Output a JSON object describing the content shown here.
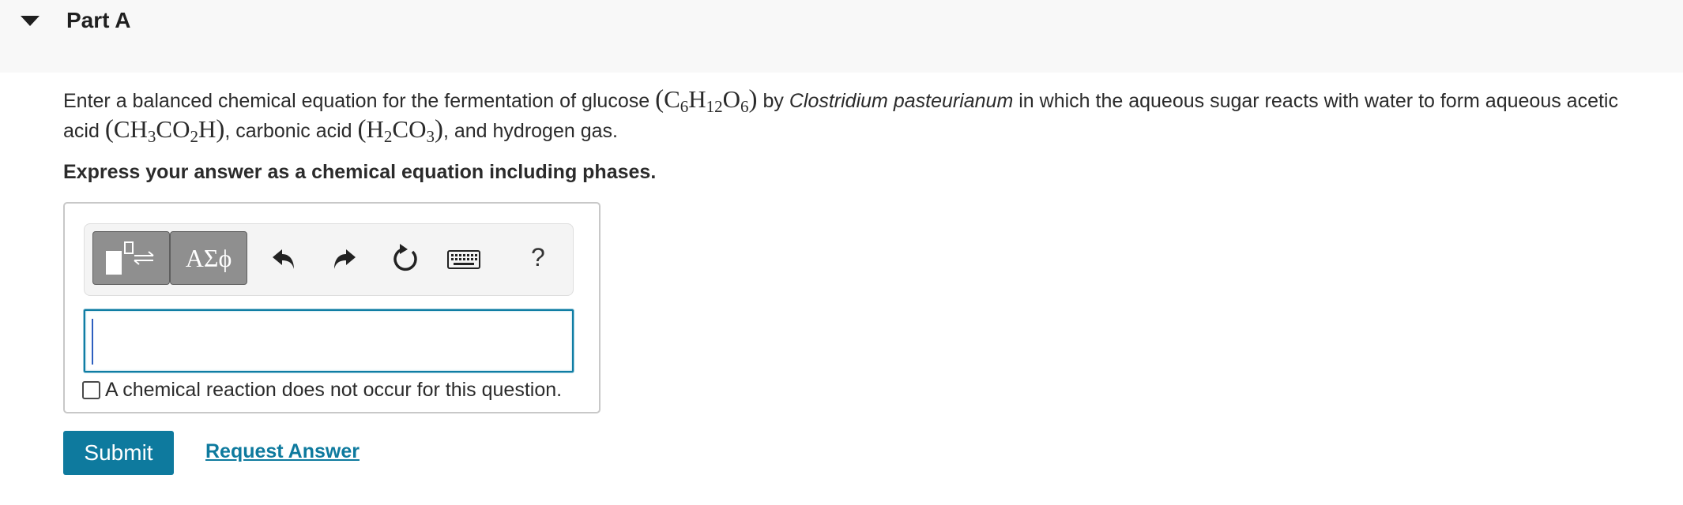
{
  "part": {
    "title": "Part A"
  },
  "question": {
    "t1": "Enter a balanced chemical equation for the fermentation of glucose ",
    "t2": " by ",
    "organism": "Clostridium pasteurianum",
    "t3": " in which the aqueous sugar reacts with water to form aqueous acetic acid ",
    "t4": ", carbonic acid ",
    "t5": ", and hydrogen gas.",
    "glucose": {
      "c": "C",
      "c_n": "6",
      "h": "H",
      "h_n": "12",
      "o": "O",
      "o_n": "6"
    },
    "acetic": {
      "ch": "CH",
      "ch_n": "3",
      "co": "CO",
      "co_n": "2",
      "h": "H"
    },
    "carbonic": {
      "h": "H",
      "h_n": "2",
      "co": "CO",
      "co_n": "3"
    }
  },
  "instruction": "Express your answer as a chemical equation including phases.",
  "toolbar": {
    "symbols_label": "ΑΣϕ",
    "help_label": "?",
    "icons": [
      "templates-icon",
      "undo-icon",
      "redo-icon",
      "reset-icon",
      "keyboard-icon"
    ]
  },
  "answer": {
    "value": ""
  },
  "no_reaction": {
    "label": "A chemical reaction does not occur for this question.",
    "checked": false
  },
  "actions": {
    "submit_label": "Submit",
    "request_label": "Request Answer"
  },
  "colors": {
    "accent": "#0e7a9e",
    "header_bg": "#f8f8f8",
    "toolbar_button": "#8f8f8f"
  }
}
